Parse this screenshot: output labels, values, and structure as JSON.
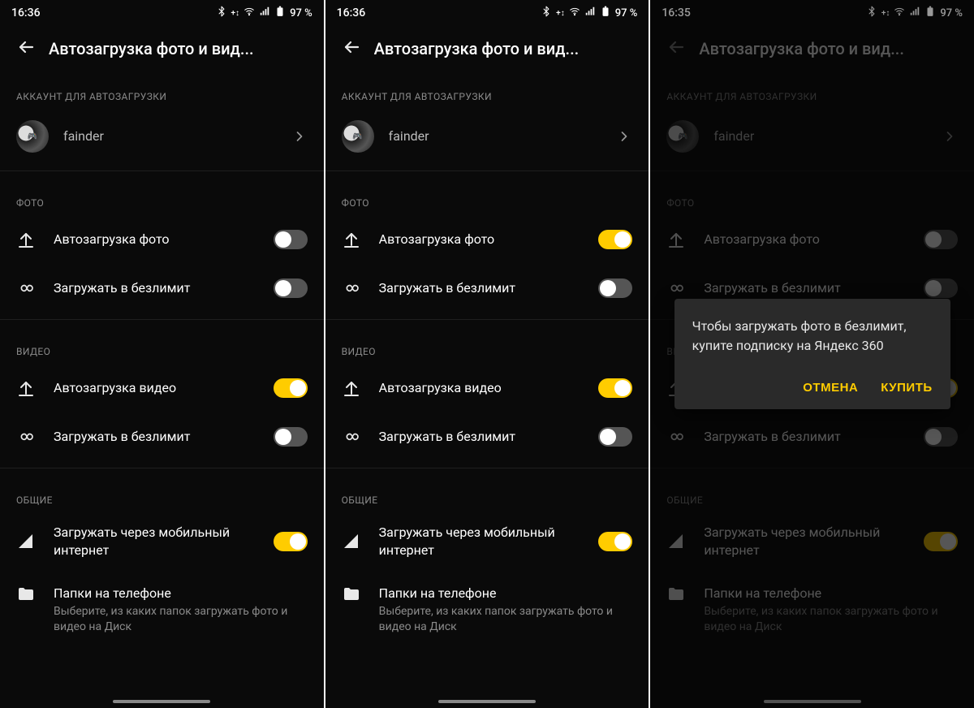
{
  "screens": [
    {
      "time": "16:36",
      "battery": "97 %",
      "title": "Автозагрузка фото и вид...",
      "account_header": "АККАУНТ ДЛЯ АВТОЗАГРУЗКИ",
      "account_name": "fainder",
      "photo_header": "ФОТО",
      "photo_auto_label": "Автозагрузка фото",
      "photo_auto_on": false,
      "photo_unlim_label": "Загружать в безлимит",
      "photo_unlim_on": false,
      "video_header": "ВИДЕО",
      "video_auto_label": "Автозагрузка видео",
      "video_auto_on": true,
      "video_unlim_label": "Загружать в безлимит",
      "video_unlim_on": false,
      "general_header": "ОБЩИЕ",
      "mobile_label": "Загружать через мобильный интернет",
      "mobile_on": true,
      "folders_label": "Папки на телефоне",
      "folders_sub": "Выберите, из каких папок загружать фото и видео на Диск",
      "dimmed": false,
      "dialog": null
    },
    {
      "time": "16:36",
      "battery": "97 %",
      "title": "Автозагрузка фото и вид...",
      "account_header": "АККАУНТ ДЛЯ АВТОЗАГРУЗКИ",
      "account_name": "fainder",
      "photo_header": "ФОТО",
      "photo_auto_label": "Автозагрузка фото",
      "photo_auto_on": true,
      "photo_unlim_label": "Загружать в безлимит",
      "photo_unlim_on": false,
      "video_header": "ВИДЕО",
      "video_auto_label": "Автозагрузка видео",
      "video_auto_on": true,
      "video_unlim_label": "Загружать в безлимит",
      "video_unlim_on": false,
      "general_header": "ОБЩИЕ",
      "mobile_label": "Загружать через мобильный интернет",
      "mobile_on": true,
      "folders_label": "Папки на телефоне",
      "folders_sub": "Выберите, из каких папок загружать фото и видео на Диск",
      "dimmed": false,
      "dialog": null
    },
    {
      "time": "16:35",
      "battery": "97 %",
      "title": "Автозагрузка фото и вид...",
      "account_header": "АККАУНТ ДЛЯ АВТОЗАГРУЗКИ",
      "account_name": "fainder",
      "photo_header": "ФОТО",
      "photo_auto_label": "Автозагрузка фото",
      "photo_auto_on": false,
      "photo_unlim_label": "Загружать в безлимит",
      "photo_unlim_on": false,
      "video_header": "ВИДЕО",
      "video_auto_label": "Автозагрузка видео",
      "video_auto_on": true,
      "video_unlim_label": "Загружать в безлимит",
      "video_unlim_on": false,
      "general_header": "ОБЩИЕ",
      "mobile_label": "Загружать через мобильный интернет",
      "mobile_on": true,
      "folders_label": "Папки на телефоне",
      "folders_sub": "Выберите, из каких папок загружать фото и видео на Диск",
      "dimmed": true,
      "dialog": {
        "text": "Чтобы загружать фото в безлимит, купите подписку на Яндекс 360",
        "cancel": "ОТМЕНА",
        "buy": "КУПИТЬ"
      }
    }
  ]
}
